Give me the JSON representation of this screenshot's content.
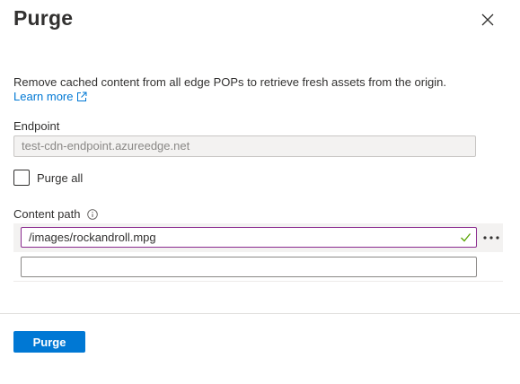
{
  "panel": {
    "title": "Purge",
    "close_icon": "close-icon"
  },
  "description": {
    "text": "Remove cached content from all edge POPs to retrieve fresh assets from the origin.",
    "learn_more": "Learn more",
    "learn_more_icon": "external-link-icon"
  },
  "endpoint": {
    "label": "Endpoint",
    "value": "test-cdn-endpoint.azureedge.net"
  },
  "purge_all": {
    "label": "Purge all",
    "checked": false
  },
  "content_path": {
    "label": "Content path",
    "info_icon": "info-icon",
    "paths": [
      {
        "value": "/images/rockandroll.mpg",
        "valid": true
      },
      {
        "value": "",
        "valid": false
      }
    ],
    "more_icon": "more-icon"
  },
  "footer": {
    "purge_button": "Purge"
  },
  "colors": {
    "accent": "#0078d4",
    "active_border": "#8a2a8e",
    "valid_check": "#57a300"
  }
}
